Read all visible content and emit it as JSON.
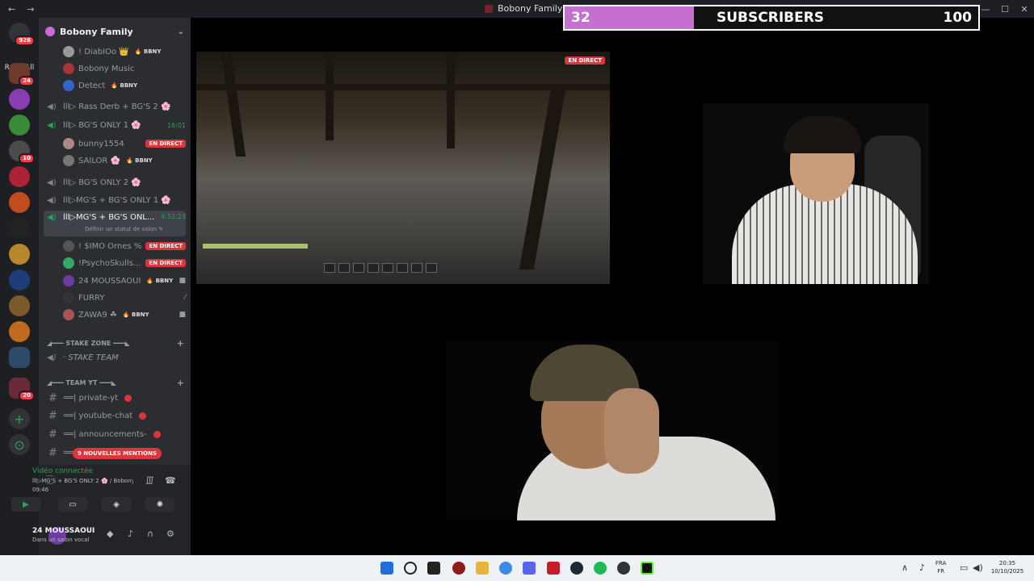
{
  "window": {
    "title": "Bobony Family",
    "nav_back": "←",
    "nav_fwd": "→",
    "min": "—",
    "max": "☐",
    "close": "✕"
  },
  "servers": {
    "dm_badge": "926",
    "read_all": "Read All",
    "badges": [
      "24",
      "10",
      "20"
    ]
  },
  "guild": {
    "name": "Bobony Family",
    "chevron": "⌄"
  },
  "users_top": [
    {
      "name": "! DiabIOo 👑",
      "tag": "🔥 BBNY"
    },
    {
      "name": "Bobony Music",
      "tag": ""
    },
    {
      "name": "Detect",
      "tag": "🔥 BBNY"
    }
  ],
  "voice1": {
    "name": "lll▷ Rass Derb + BG'S 2 🌸"
  },
  "voice2": {
    "name": "lll▷ BG'S ONLY 1 🌸",
    "timer": "16:01"
  },
  "voice2_users": [
    {
      "name": "bunny1554",
      "live": "EN DIRECT",
      "tag": ""
    },
    {
      "name": "SAILOR 🌸",
      "live": "",
      "tag": "🔥 BBNY"
    }
  ],
  "voice3": {
    "name": "lll▷ BG'S ONLY 2 🌸"
  },
  "voice4": {
    "name": "lll▷MG'S + BG'S ONLY 1 🌸"
  },
  "voice5": {
    "name": "lll▷MG'S + BG'S ONL...",
    "timer": "4:52:23",
    "status_hint": "Définir un statut de salon ✎"
  },
  "voice5_users": [
    {
      "name": "! $IMO Ornes %",
      "live": "EN DIRECT",
      "tag": ""
    },
    {
      "name": "!PsychoSkulls...",
      "live": "EN DIRECT",
      "tag": ""
    },
    {
      "name": "24 MOUSSAOUI",
      "live": "",
      "tag": "🔥 BBNY"
    },
    {
      "name": "FURRY",
      "live": "",
      "tag": ""
    },
    {
      "name": "ZAWA9 ☘",
      "live": "",
      "tag": "🔥 BBNY"
    }
  ],
  "cat_stake": {
    "name": "◢━━━ STAKE ZONE ━━━◣",
    "plus": "+"
  },
  "stake_team": {
    "name": "· STAKE TEAM"
  },
  "cat_team": {
    "name": "◢━━━ TEAM YT ━━━◣",
    "plus": "+"
  },
  "text_channels": [
    {
      "name": "══| private-yt"
    },
    {
      "name": "══| youtube-chat"
    },
    {
      "name": "══| announcements-"
    },
    {
      "name": "══"
    }
  ],
  "mentions": "9 NOUVELLES MENTIONS",
  "voice_panel": {
    "status": "Vidéo connectée",
    "where": "lll▷MG'S + BG'S ONLY 2 🌸 / Bobony...",
    "elapsed": "09:46"
  },
  "user": {
    "name": "24 MOUSSAOUI",
    "status": "Dans un salon vocal"
  },
  "overlay": {
    "current": "32",
    "label": "SUBSCRIBERS",
    "goal": "100",
    "progress": 0.32,
    "color": "#c56fcf"
  },
  "stream": {
    "live": "EN DIRECT"
  },
  "taskbar": {
    "lang1": "FRA",
    "lang2": "FR",
    "time": "20:35",
    "date": "10/10/2025"
  },
  "colors": {
    "accent": "#23a55a",
    "danger": "#da373c",
    "sidebar": "#2b2d31"
  }
}
